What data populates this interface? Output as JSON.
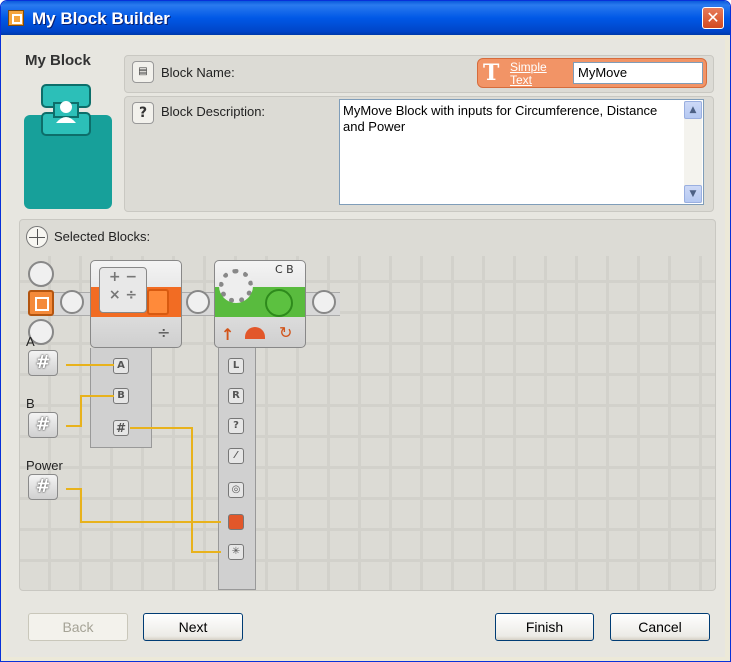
{
  "window": {
    "title": "My Block Builder",
    "close_glyph": "✕"
  },
  "left": {
    "label": "My Block"
  },
  "name_panel": {
    "label": "Block Name:",
    "mode_label": "Simple Text",
    "name_value": "MyMove",
    "icon_glyph": "T"
  },
  "desc_panel": {
    "label": "Block Description:",
    "value": "MyMove Block with inputs for Circumference, Distance and Power",
    "help_glyph": "?"
  },
  "selected": {
    "label": "Selected Blocks:"
  },
  "blocks": {
    "inputs": [
      "A",
      "B",
      "Power"
    ],
    "hash_glyph": "#",
    "math_ports": [
      "A",
      "B"
    ],
    "math_symbol": "÷",
    "move_ports_label": "C B",
    "math_icon_glyph": "+ −\n× ÷"
  },
  "buttons": {
    "back": "Back",
    "next": "Next",
    "finish": "Finish",
    "cancel": "Cancel"
  },
  "colors": {
    "titlebar": "#0058e6",
    "accent_orange": "#f29466",
    "block_teal": "#17a09a",
    "wire": "#e8b21c"
  }
}
